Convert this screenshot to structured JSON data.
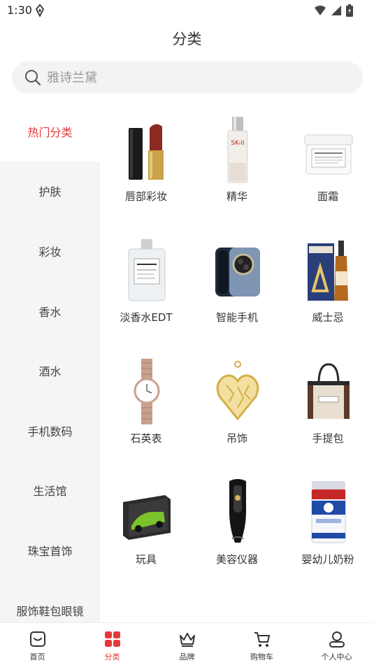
{
  "status_bar": {
    "time": "1:30"
  },
  "header": {
    "title": "分类"
  },
  "search": {
    "placeholder": "雅诗兰黛"
  },
  "sidebar": {
    "items": [
      {
        "label": "热门分类",
        "active": true
      },
      {
        "label": "护肤"
      },
      {
        "label": "彩妆"
      },
      {
        "label": "香水"
      },
      {
        "label": "酒水"
      },
      {
        "label": "手机数码"
      },
      {
        "label": "生活馆"
      },
      {
        "label": "珠宝首饰"
      },
      {
        "label": "服饰鞋包眼镜"
      }
    ]
  },
  "products": [
    {
      "label": "唇部彩妆",
      "icon": "lipstick-icon"
    },
    {
      "label": "精华",
      "icon": "serum-bottle-icon"
    },
    {
      "label": "面霜",
      "icon": "cream-jar-icon"
    },
    {
      "label": "淡香水EDT",
      "icon": "perfume-bottle-icon"
    },
    {
      "label": "智能手机",
      "icon": "smartphone-icon"
    },
    {
      "label": "威士忌",
      "icon": "whisky-bottle-icon"
    },
    {
      "label": "石英表",
      "icon": "wristwatch-icon"
    },
    {
      "label": "吊饰",
      "icon": "heart-pendant-icon"
    },
    {
      "label": "手提包",
      "icon": "tote-bag-icon"
    },
    {
      "label": "玩具",
      "icon": "toy-car-box-icon"
    },
    {
      "label": "美容仪器",
      "icon": "beauty-device-icon"
    },
    {
      "label": "婴幼儿奶粉",
      "icon": "milk-powder-can-icon"
    }
  ],
  "tab_bar": {
    "tabs": [
      {
        "label": "首页",
        "icon": "home-icon"
      },
      {
        "label": "分类",
        "icon": "category-grid-icon",
        "active": true
      },
      {
        "label": "品牌",
        "icon": "crown-icon"
      },
      {
        "label": "购物车",
        "icon": "cart-icon"
      },
      {
        "label": "个人中心",
        "icon": "user-icon"
      }
    ]
  },
  "colors": {
    "accent": "#e4393c",
    "sidebar_bg": "#f5f5f5",
    "search_bg": "#f3f3f3"
  }
}
